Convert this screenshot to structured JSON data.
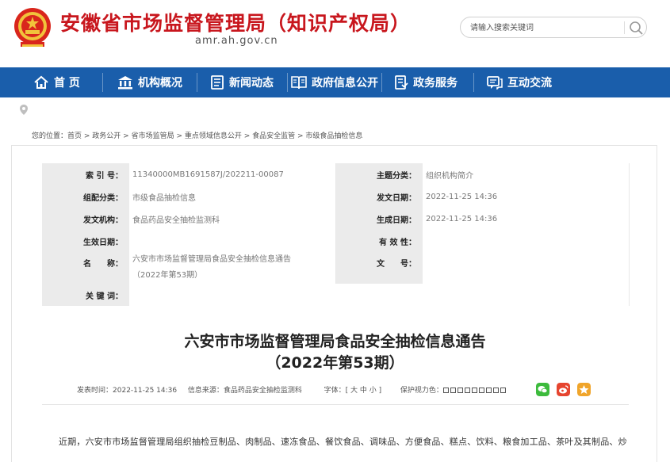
{
  "header": {
    "title": "安徽省市场监督管理局（知识产权局）",
    "domain": "amr.ah.gov.cn",
    "search_placeholder": "请输入搜索关键词",
    "emblem_icon": "national-emblem-icon"
  },
  "nav": {
    "items": [
      {
        "label": "首 页",
        "icon": "home-icon"
      },
      {
        "label": "机构概况",
        "icon": "institution-icon"
      },
      {
        "label": "新闻动态",
        "icon": "news-icon"
      },
      {
        "label": "政府信息公开",
        "icon": "open-info-icon"
      },
      {
        "label": "政务服务",
        "icon": "service-icon"
      },
      {
        "label": "互动交流",
        "icon": "chat-icon"
      }
    ],
    "bg_color": "#1a5eab"
  },
  "breadcrumb": {
    "prefix": "您的位置：",
    "items": [
      "首页",
      "政务公开",
      "省市场监管局",
      "重点领域信息公开",
      "食品安全监管",
      "市级食品抽检信息"
    ],
    "sep": " > "
  },
  "meta": {
    "rows": [
      {
        "l1": "索 引 号：",
        "v1": "11340000MB1691587J/202211-00087",
        "l2": "主题分类：",
        "v2": "组织机构简介"
      },
      {
        "l1": "组配分类：",
        "v1": "市级食品抽检信息",
        "l2": "发文日期：",
        "v2": "2022-11-25 14:36"
      },
      {
        "l1": "发文机构：",
        "v1": "食品药品安全抽检监测科",
        "l2": "生成日期：",
        "v2": "2022-11-25 14:36"
      },
      {
        "l1": "生效日期：",
        "v1": "",
        "l2": "有 效 性：",
        "v2": ""
      },
      {
        "l1": "名　　称：",
        "v1": "六安市市场监督管理局食品安全抽检信息通告",
        "v1b": "（2022年第53期）",
        "l2": "文　　号：",
        "v2": ""
      },
      {
        "l1": "关 键 词：",
        "v1": "",
        "l2": "",
        "v2": ""
      }
    ]
  },
  "article": {
    "title_line1": "六安市市场监督管理局食品安全抽检信息通告",
    "title_line2": "（2022年第53期）",
    "publish_label": "发表时间：",
    "publish_time": "2022-11-25 14:36",
    "source_label": "信息来源：",
    "source": "食品药品安全抽检监测科",
    "font_label": "字体：",
    "font_options": "[ 大 中 小 ]",
    "eye_label": "保护视力色：",
    "eye_colors": [
      "#fafafa",
      "#fafafa",
      "#fafafa",
      "#fafafa",
      "#fafafa",
      "#fafafa",
      "#fafafa",
      "#fafafa",
      "#fafafa"
    ],
    "share_icons": [
      {
        "name": "wechat-share-icon",
        "color": "#3dbb3d"
      },
      {
        "name": "weibo-share-icon",
        "color": "#e6452f"
      },
      {
        "name": "qzone-share-icon",
        "color": "#f0a52b"
      }
    ],
    "body": "近期，六安市市场监督管理局组织抽检豆制品、肉制品、速冻食品、餐饮食品、调味品、方便食品、糕点、饮料、粮食加工品、茶叶及其制品、炒"
  }
}
